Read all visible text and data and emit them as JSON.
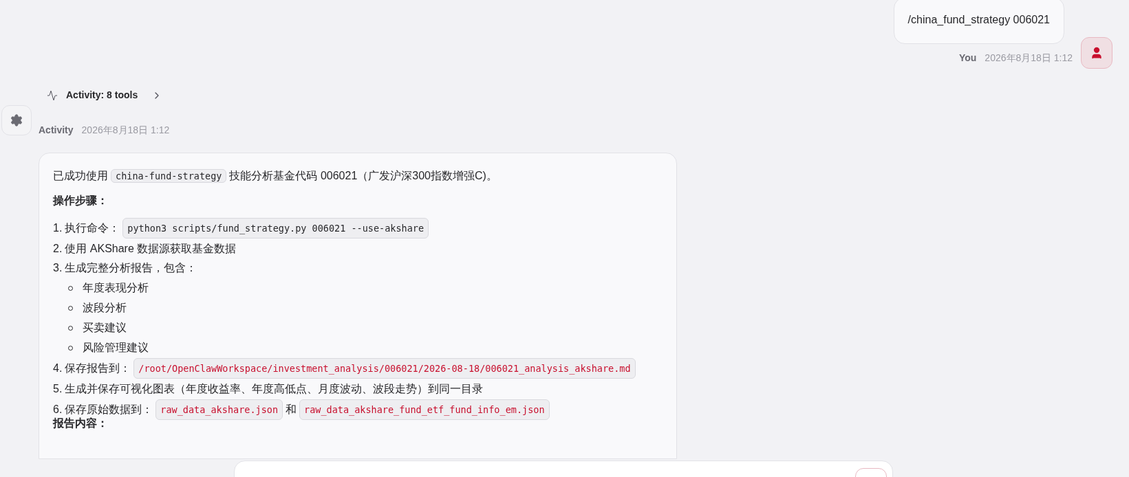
{
  "user_message": {
    "text": "/china_fund_strategy 006021",
    "author": "You",
    "time": "2026年8月18日 1:12"
  },
  "activity": {
    "summary": "Activity: 8 tools",
    "expanded": false,
    "author": "Activity",
    "time": "2026年8月18日 1:12"
  },
  "reply": {
    "intro": [
      {
        "kind": "text",
        "text": "已成功使用"
      },
      {
        "kind": "code",
        "text": "china-fund-strategy"
      },
      {
        "kind": "text",
        "text": "技能分析基金代码 006021（广发沪深300指数增强C)。"
      }
    ],
    "steps_heading": "操作步骤：",
    "steps": [
      {
        "number": "1.",
        "parts": [
          {
            "kind": "text",
            "text": "执行命令："
          },
          {
            "kind": "code",
            "text": "python3 scripts/fund_strategy.py 006021 --use-akshare"
          }
        ]
      },
      {
        "number": "2.",
        "parts": [
          {
            "kind": "text",
            "text": "使用 AKShare 数据源获取基金数据"
          }
        ]
      },
      {
        "number": "3.",
        "parts": [
          {
            "kind": "text",
            "text": "生成完整分析报告，包含："
          }
        ],
        "children": [
          "年度表现分析",
          "波段分析",
          "买卖建议",
          "风险管理建议"
        ]
      },
      {
        "number": "4.",
        "parts": [
          {
            "kind": "text",
            "text": "保存报告到："
          },
          {
            "kind": "file",
            "text": "/root/OpenClawWorkspace/investment_analysis/006021/2026-08-18/006021_analysis_akshare.md"
          }
        ]
      },
      {
        "number": "5.",
        "parts": [
          {
            "kind": "text",
            "text": "生成并保存可视化图表（年度收益率、年度高低点、月度波动、波段走势）到同一目录"
          }
        ]
      },
      {
        "number": "6.",
        "parts": [
          {
            "kind": "text",
            "text": "保存原始数据到："
          },
          {
            "kind": "file",
            "text": "raw_data_akshare.json"
          },
          {
            "kind": "text",
            "text": "和"
          },
          {
            "kind": "file",
            "text": "raw_data_akshare_fund_etf_fund_info_em.json"
          }
        ]
      }
    ],
    "report_heading": "报告内容："
  }
}
